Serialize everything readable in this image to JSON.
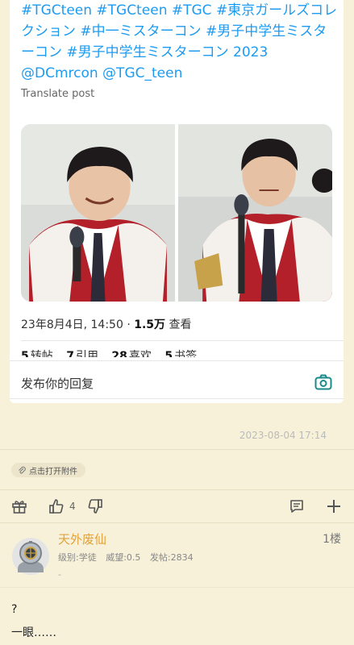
{
  "tweet": {
    "text": "#TGCteen #TGCteen #TGC #東京ガールズコレクション #中一ミスターコン #男子中学生ミスターコン #男子中学生ミスターコン 2023 @DCmrcon @TGC_teen",
    "translate": "Translate post",
    "meta_date": "23年8月4日, 14:50 · ",
    "meta_views": "1.5万",
    "meta_views_label": " 查看",
    "stats": [
      {
        "num": "5",
        "label": "转帖"
      },
      {
        "num": "7",
        "label": "引用"
      },
      {
        "num": "28",
        "label": "喜欢"
      },
      {
        "num": "5",
        "label": "书签"
      }
    ],
    "reply_placeholder": "发布你的回复",
    "photo_icon": "camera-icon"
  },
  "post_meta": {
    "timestamp": "2023-08-04 17:14",
    "attachment_label": "点击打开附件",
    "like_count": "4",
    "icons": [
      "gift-icon",
      "thumbs-up-icon",
      "thumbs-down-icon",
      "comment-icon",
      "plus-icon"
    ]
  },
  "reply": {
    "username": "天外废仙",
    "floor": "1楼",
    "level_label": "级别:学徒",
    "reputation_label": "威望:0.5",
    "posts_label": "发帖:2834",
    "signature": "-",
    "lines": [
      "?",
      "一眼……"
    ]
  },
  "colors": {
    "background": "#f7f1d9",
    "link": "#1d9bf0",
    "username": "#e2a23b"
  }
}
